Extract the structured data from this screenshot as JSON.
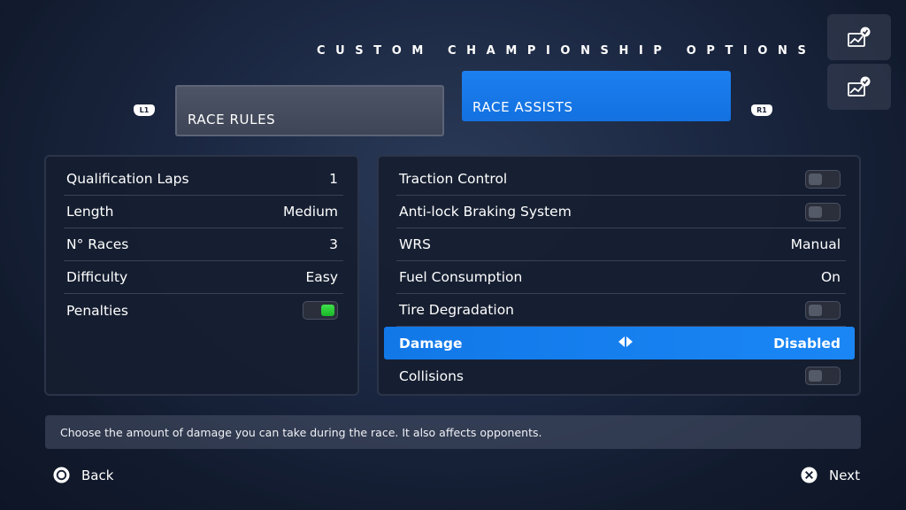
{
  "header": {
    "title": "CUSTOM CHAMPIONSHIP OPTIONS",
    "left_shoulder": "L1",
    "right_shoulder": "R1"
  },
  "tabs": [
    {
      "label": "RACE RULES",
      "active": false
    },
    {
      "label": "RACE ASSISTS",
      "active": true
    }
  ],
  "corner_icons": [
    "chart-check-icon",
    "chart-check-icon"
  ],
  "race_rules": [
    {
      "label": "Qualification Laps",
      "value": "1"
    },
    {
      "label": "Length",
      "value": "Medium"
    },
    {
      "label": "N° Races",
      "value": "3"
    },
    {
      "label": "Difficulty",
      "value": "Easy"
    },
    {
      "label": "Penalties",
      "toggle": true
    }
  ],
  "race_assists": [
    {
      "label": "Traction Control",
      "toggle": false
    },
    {
      "label": "Anti-lock Braking System",
      "toggle": false
    },
    {
      "label": "WRS",
      "value": "Manual"
    },
    {
      "label": "Fuel Consumption",
      "value": "On"
    },
    {
      "label": "Tire Degradation",
      "toggle": false
    },
    {
      "label": "Damage",
      "value": "Disabled",
      "selected": true
    },
    {
      "label": "Collisions",
      "toggle": false
    }
  ],
  "hint": "Choose the amount of damage you can take during the race. It also affects opponents.",
  "footer": {
    "back_label": "Back",
    "next_label": "Next"
  },
  "colors": {
    "accent_blue": "#1a86f5",
    "toggle_on_green": "#3fe04a",
    "panel_bg": "#161e30"
  }
}
